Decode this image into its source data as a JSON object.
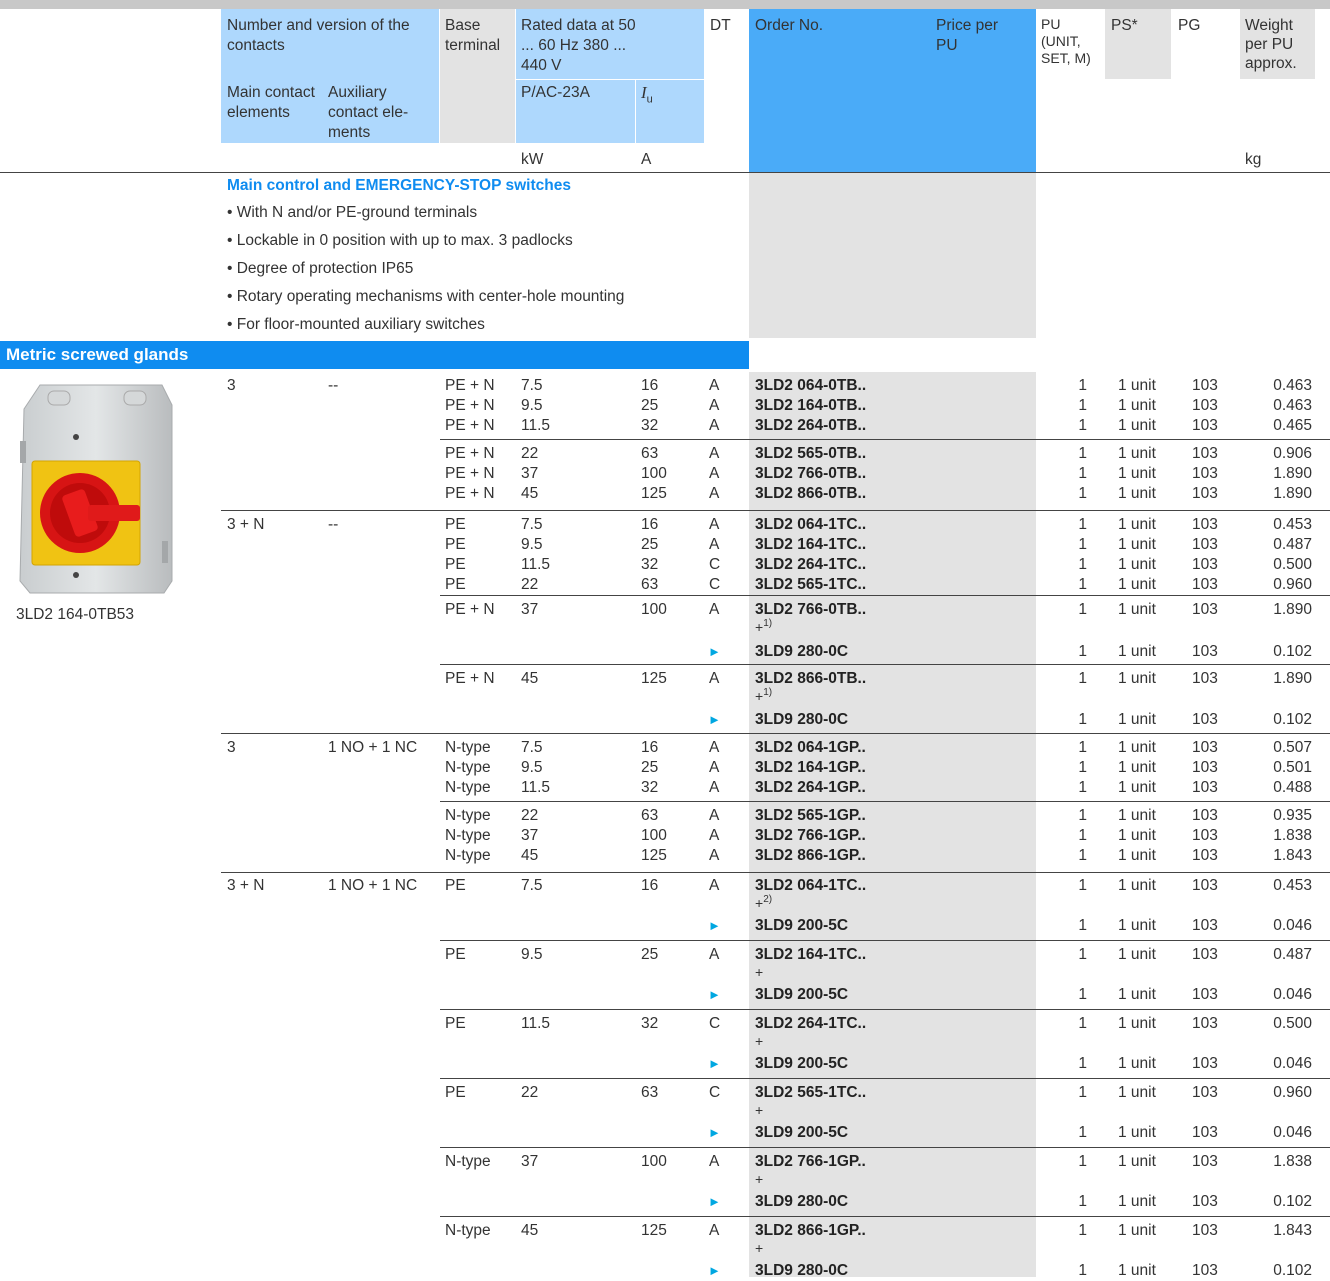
{
  "header": {
    "contacts": "Number and version of the contacts",
    "main_contact": "Main contact elements",
    "aux_contact": "Auxiliary contact ele-ments",
    "base_terminal": "Base terminal",
    "rated_data": "Rated data at 50 ... 60 Hz 380 ... 440 V",
    "pac23a": "P/AC-23A",
    "iu_main": "I",
    "iu_sub": "u",
    "kw": "kW",
    "a_unit": "A",
    "dt": "DT",
    "order_no": "Order No.",
    "price": "Price per PU",
    "pu": "PU (UNIT, SET, M)",
    "ps": "PS*",
    "pg": "PG",
    "weight": "Weight per PU approx.",
    "kg": "kg"
  },
  "intro": {
    "title": "Main control and EMERGENCY-STOP switches",
    "bullets": [
      "• With N and/or PE-ground terminals",
      "• Lockable in 0 position with up to max. 3 padlocks",
      "• Degree of protection IP65",
      "• Rotary operating mechanisms with center-hole mounting",
      "• For floor-mounted auxiliary switches"
    ]
  },
  "section": {
    "title": "Metric screwed glands"
  },
  "image": {
    "caption": "3LD2 164-0TB53"
  },
  "colors": {
    "blue": "#0f8cf0",
    "lightblue": "#aed8fd",
    "gray": "#e3e3e3",
    "arrow": "#00a7e1"
  },
  "rows": [
    {
      "main": "3",
      "aux": "--",
      "base": "PE + N",
      "kw": "7.5",
      "a": "16",
      "dt": "A",
      "order": "3LD2 064-0TB..",
      "pu": "1",
      "ps": "1 unit",
      "pg": "103",
      "wt": "0.463"
    },
    {
      "base": "PE + N",
      "kw": "9.5",
      "a": "25",
      "dt": "A",
      "order": "3LD2 164-0TB..",
      "pu": "1",
      "ps": "1 unit",
      "pg": "103",
      "wt": "0.463"
    },
    {
      "base": "PE + N",
      "kw": "11.5",
      "a": "32",
      "dt": "A",
      "order": "3LD2 264-0TB..",
      "pu": "1",
      "ps": "1 unit",
      "pg": "103",
      "wt": "0.465"
    },
    {
      "base": "PE + N",
      "kw": "22",
      "a": "63",
      "dt": "A",
      "order": "3LD2 565-0TB..",
      "pu": "1",
      "ps": "1 unit",
      "pg": "103",
      "wt": "0.906"
    },
    {
      "base": "PE + N",
      "kw": "37",
      "a": "100",
      "dt": "A",
      "order": "3LD2 766-0TB..",
      "pu": "1",
      "ps": "1 unit",
      "pg": "103",
      "wt": "1.890"
    },
    {
      "base": "PE + N",
      "kw": "45",
      "a": "125",
      "dt": "A",
      "order": "3LD2 866-0TB..",
      "pu": "1",
      "ps": "1 unit",
      "pg": "103",
      "wt": "1.890"
    },
    {
      "main": "3 + N",
      "aux": "--",
      "base": "PE",
      "kw": "7.5",
      "a": "16",
      "dt": "A",
      "order": "3LD2 064-1TC..",
      "pu": "1",
      "ps": "1 unit",
      "pg": "103",
      "wt": "0.453"
    },
    {
      "base": "PE",
      "kw": "9.5",
      "a": "25",
      "dt": "A",
      "order": "3LD2 164-1TC..",
      "pu": "1",
      "ps": "1 unit",
      "pg": "103",
      "wt": "0.487"
    },
    {
      "base": "PE",
      "kw": "11.5",
      "a": "32",
      "dt": "C",
      "order": "3LD2 264-1TC..",
      "pu": "1",
      "ps": "1 unit",
      "pg": "103",
      "wt": "0.500"
    },
    {
      "base": "PE",
      "kw": "22",
      "a": "63",
      "dt": "C",
      "order": "3LD2 565-1TC..",
      "pu": "1",
      "ps": "1 unit",
      "pg": "103",
      "wt": "0.960"
    },
    {
      "base": "PE + N",
      "kw": "37",
      "a": "100",
      "dt": "A",
      "order": "3LD2 766-0TB..",
      "plus": "+",
      "sup": "1)",
      "pu": "1",
      "ps": "1 unit",
      "pg": "103",
      "wt": "1.890"
    },
    {
      "arrow": "►",
      "order": "3LD9 280-0C",
      "pu": "1",
      "ps": "1 unit",
      "pg": "103",
      "wt": "0.102"
    },
    {
      "base": "PE + N",
      "kw": "45",
      "a": "125",
      "dt": "A",
      "order": "3LD2 866-0TB..",
      "plus": "+",
      "sup": "1)",
      "pu": "1",
      "ps": "1 unit",
      "pg": "103",
      "wt": "1.890"
    },
    {
      "arrow": "►",
      "order": "3LD9 280-0C",
      "pu": "1",
      "ps": "1 unit",
      "pg": "103",
      "wt": "0.102"
    },
    {
      "main": "3",
      "aux": "1 NO + 1 NC",
      "base": "N-type",
      "kw": "7.5",
      "a": "16",
      "dt": "A",
      "order": "3LD2 064-1GP..",
      "pu": "1",
      "ps": "1 unit",
      "pg": "103",
      "wt": "0.507"
    },
    {
      "base": "N-type",
      "kw": "9.5",
      "a": "25",
      "dt": "A",
      "order": "3LD2 164-1GP..",
      "pu": "1",
      "ps": "1 unit",
      "pg": "103",
      "wt": "0.501"
    },
    {
      "base": "N-type",
      "kw": "11.5",
      "a": "32",
      "dt": "A",
      "order": "3LD2 264-1GP..",
      "pu": "1",
      "ps": "1 unit",
      "pg": "103",
      "wt": "0.488"
    },
    {
      "base": "N-type",
      "kw": "22",
      "a": "63",
      "dt": "A",
      "order": "3LD2 565-1GP..",
      "pu": "1",
      "ps": "1 unit",
      "pg": "103",
      "wt": "0.935"
    },
    {
      "base": "N-type",
      "kw": "37",
      "a": "100",
      "dt": "A",
      "order": "3LD2 766-1GP..",
      "pu": "1",
      "ps": "1 unit",
      "pg": "103",
      "wt": "1.838"
    },
    {
      "base": "N-type",
      "kw": "45",
      "a": "125",
      "dt": "A",
      "order": "3LD2 866-1GP..",
      "pu": "1",
      "ps": "1 unit",
      "pg": "103",
      "wt": "1.843"
    },
    {
      "main": "3 + N",
      "aux": "1 NO + 1 NC",
      "base": "PE",
      "kw": "7.5",
      "a": "16",
      "dt": "A",
      "order": "3LD2 064-1TC..",
      "plus": "+",
      "sup": "2)",
      "pu": "1",
      "ps": "1 unit",
      "pg": "103",
      "wt": "0.453"
    },
    {
      "arrow": "►",
      "order": "3LD9 200-5C",
      "pu": "1",
      "ps": "1 unit",
      "pg": "103",
      "wt": "0.046"
    },
    {
      "base": "PE",
      "kw": "9.5",
      "a": "25",
      "dt": "A",
      "order": "3LD2 164-1TC..",
      "plus": "+",
      "pu": "1",
      "ps": "1 unit",
      "pg": "103",
      "wt": "0.487"
    },
    {
      "arrow": "►",
      "order": "3LD9 200-5C",
      "pu": "1",
      "ps": "1 unit",
      "pg": "103",
      "wt": "0.046"
    },
    {
      "base": "PE",
      "kw": "11.5",
      "a": "32",
      "dt": "C",
      "order": "3LD2 264-1TC..",
      "plus": "+",
      "pu": "1",
      "ps": "1 unit",
      "pg": "103",
      "wt": "0.500"
    },
    {
      "arrow": "►",
      "order": "3LD9 200-5C",
      "pu": "1",
      "ps": "1 unit",
      "pg": "103",
      "wt": "0.046"
    },
    {
      "base": "PE",
      "kw": "22",
      "a": "63",
      "dt": "C",
      "order": "3LD2 565-1TC..",
      "plus": "+",
      "pu": "1",
      "ps": "1 unit",
      "pg": "103",
      "wt": "0.960"
    },
    {
      "arrow": "►",
      "order": "3LD9 200-5C",
      "pu": "1",
      "ps": "1 unit",
      "pg": "103",
      "wt": "0.046"
    },
    {
      "base": "N-type",
      "kw": "37",
      "a": "100",
      "dt": "A",
      "order": "3LD2 766-1GP..",
      "plus": "+",
      "pu": "1",
      "ps": "1 unit",
      "pg": "103",
      "wt": "1.838"
    },
    {
      "arrow": "►",
      "order": "3LD9 280-0C",
      "pu": "1",
      "ps": "1 unit",
      "pg": "103",
      "wt": "0.102"
    },
    {
      "base": "N-type",
      "kw": "45",
      "a": "125",
      "dt": "A",
      "order": "3LD2 866-1GP..",
      "plus": "+",
      "pu": "1",
      "ps": "1 unit",
      "pg": "103",
      "wt": "1.843"
    },
    {
      "arrow": "►",
      "order": "3LD9 280-0C",
      "pu": "1",
      "ps": "1 unit",
      "pg": "103",
      "wt": "0.102"
    }
  ]
}
